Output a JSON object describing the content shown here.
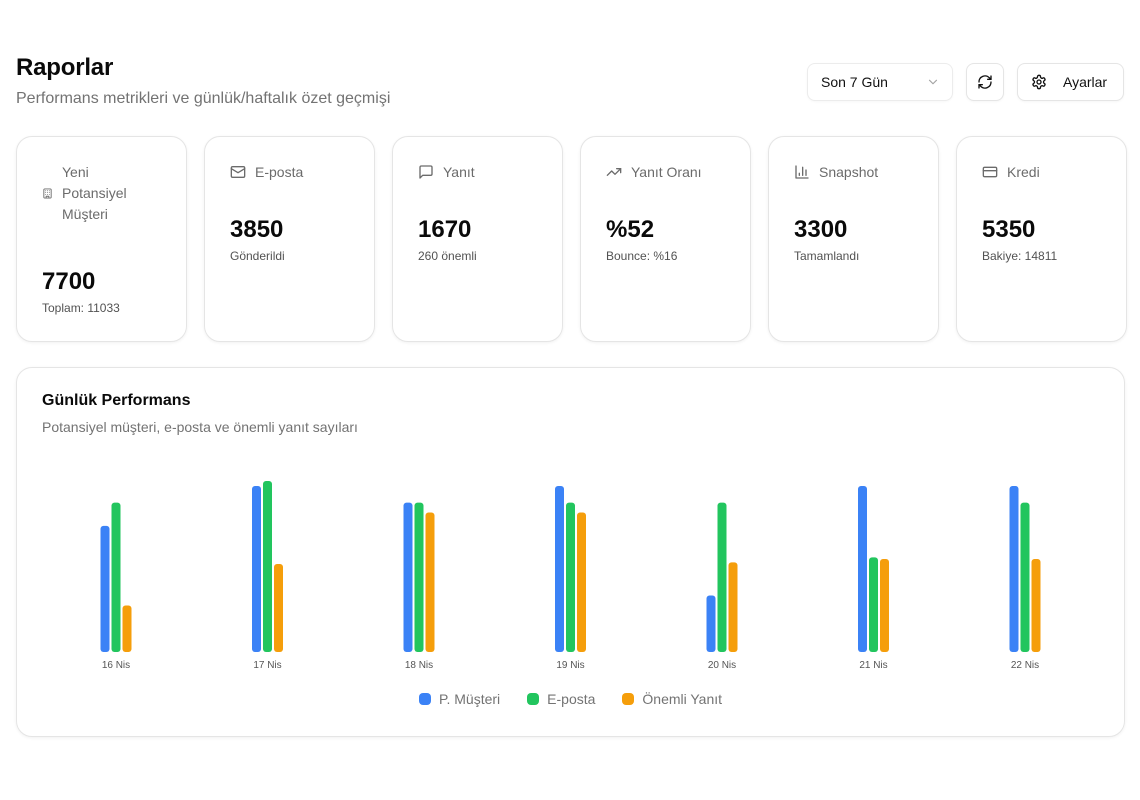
{
  "header": {
    "title": "Raporlar",
    "subtitle": "Performans metrikleri ve günlük/haftalık özet geçmişi"
  },
  "controls": {
    "period_select": "Son 7 Gün",
    "settings_label": "Ayarlar"
  },
  "cards": [
    {
      "label": "Yeni Potansiyel Müşteri",
      "icon": "building-icon",
      "value": "7700",
      "sub": "Toplam: 11033"
    },
    {
      "label": "E-posta",
      "icon": "mail-icon",
      "value": "3850",
      "sub": "Gönderildi"
    },
    {
      "label": "Yanıt",
      "icon": "message-icon",
      "value": "1670",
      "sub": "260 önemli"
    },
    {
      "label": "Yanıt Oranı",
      "icon": "trending-up-icon",
      "value": "%52",
      "sub": "Bounce: %16"
    },
    {
      "label": "Snapshot",
      "icon": "bar-chart-icon",
      "value": "3300",
      "sub": "Tamamlandı"
    },
    {
      "label": "Kredi",
      "icon": "credit-card-icon",
      "value": "5350",
      "sub": "Bakiye: 14811"
    }
  ],
  "chart": {
    "title": "Günlük Performans",
    "subtitle": "Potansiyel müşteri, e-posta ve önemli yanıt sayıları"
  },
  "chart_data": {
    "type": "bar",
    "categories": [
      "16 Nis",
      "17 Nis",
      "18 Nis",
      "19 Nis",
      "20 Nis",
      "21 Nis",
      "22 Nis"
    ],
    "series": [
      {
        "name": "P. Müşteri",
        "color": "#3b82f6",
        "values": [
          76,
          100,
          90,
          100,
          34,
          100,
          100
        ]
      },
      {
        "name": "E-posta",
        "color": "#22c55e",
        "values": [
          90,
          103,
          90,
          90,
          90,
          57,
          90
        ]
      },
      {
        "name": "Önemli Yanıt",
        "color": "#f59e0b",
        "values": [
          28,
          53,
          84,
          84,
          54,
          56,
          56
        ]
      }
    ],
    "ylim": [
      0,
      103
    ],
    "grid": false,
    "legend": "bottom-center"
  }
}
